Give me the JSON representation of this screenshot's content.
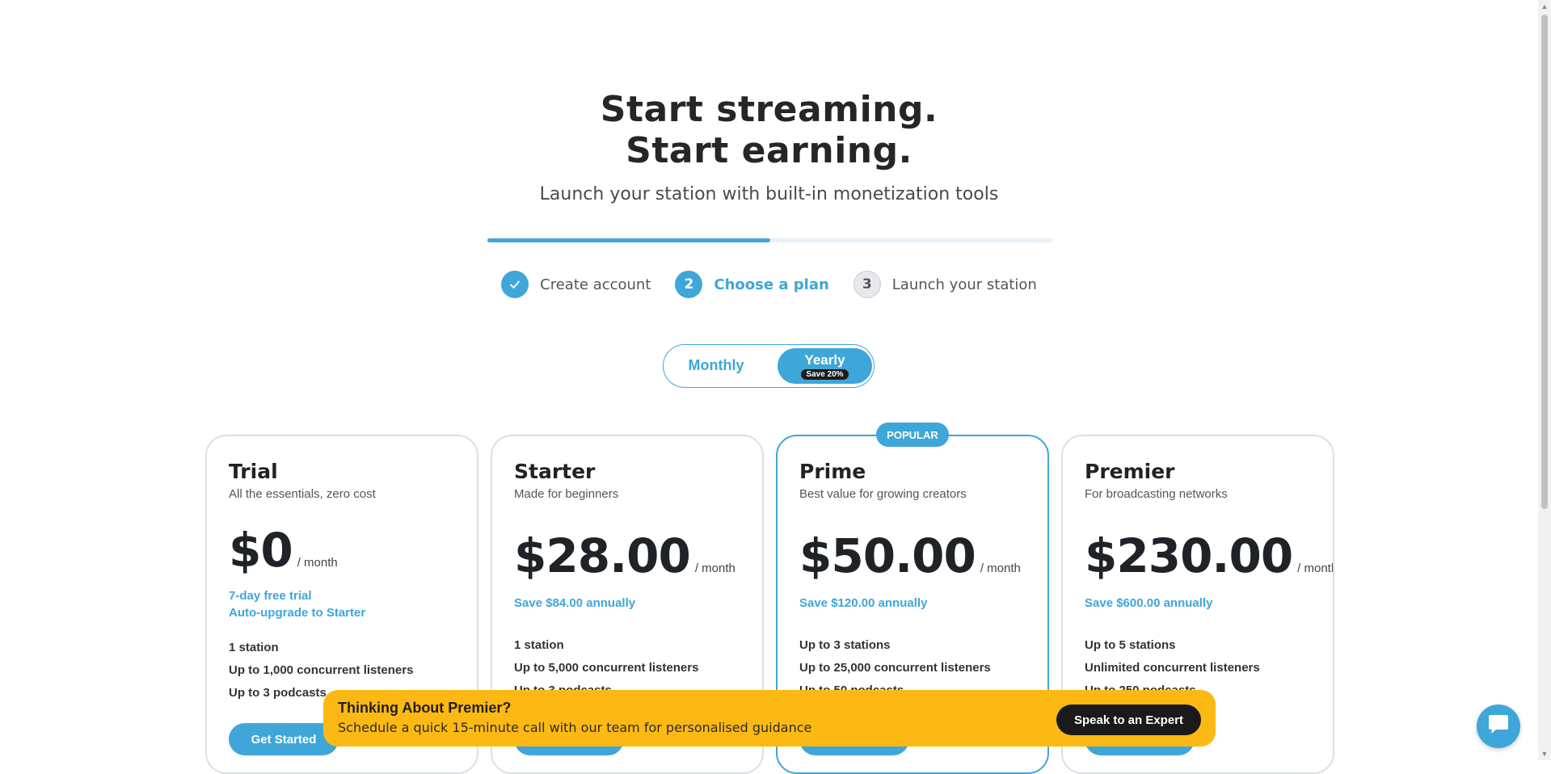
{
  "hero": {
    "title_line1": "Start streaming.",
    "title_line2": "Start earning.",
    "subtitle": "Launch your station with built-in monetization tools"
  },
  "progress": {
    "fraction": 0.5
  },
  "steps": [
    {
      "number": "✓",
      "label": "Create account",
      "state": "done"
    },
    {
      "number": "2",
      "label": "Choose a plan",
      "state": "active"
    },
    {
      "number": "3",
      "label": "Launch your station",
      "state": "pending"
    }
  ],
  "billing": {
    "monthly_label": "Monthly",
    "yearly_label": "Yearly",
    "yearly_badge": "Save 20%",
    "selected": "yearly"
  },
  "popular_badge": "POPULAR",
  "plans": [
    {
      "name": "Trial",
      "desc": "All the essentials, zero cost",
      "price": "$0",
      "per": "/ month",
      "note_line1": "7-day free trial",
      "note_line2": "Auto-upgrade to Starter",
      "features": [
        "1 station",
        "Up to 1,000 concurrent listeners",
        "Up to 3 podcasts"
      ],
      "cta": "Get Started"
    },
    {
      "name": "Starter",
      "desc": "Made for beginners",
      "price": "$28.00",
      "per": "/ month",
      "note_line1": "Save $84.00 annually",
      "note_line2": "",
      "features": [
        "1 station",
        "Up to 5,000 concurrent listeners",
        "Up to 3 podcasts"
      ],
      "cta": "Get Started"
    },
    {
      "name": "Prime",
      "desc": "Best value for growing creators",
      "price": "$50.00",
      "per": "/ month",
      "note_line1": "Save $120.00 annually",
      "note_line2": "",
      "features": [
        "Up to 3 stations",
        "Up to 25,000 concurrent listeners",
        "Up to 50 podcasts"
      ],
      "cta": "Get Started"
    },
    {
      "name": "Premier",
      "desc": "For broadcasting networks",
      "price": "$230.00",
      "per": "/ month",
      "note_line1": "Save $600.00 annually",
      "note_line2": "",
      "features": [
        "Up to 5 stations",
        "Unlimited concurrent listeners",
        "Up to 250 podcasts"
      ],
      "cta": "Get Started"
    }
  ],
  "banner": {
    "title": "Thinking About Premier?",
    "text": "Schedule a quick 15-minute call with our team for personalised guidance",
    "cta": "Speak to an Expert"
  },
  "chat": {
    "icon": "chat-bubble-icon"
  },
  "colors": {
    "accent": "#3ea6d9",
    "banner": "#fdb913",
    "dark": "#1a1a1a"
  }
}
